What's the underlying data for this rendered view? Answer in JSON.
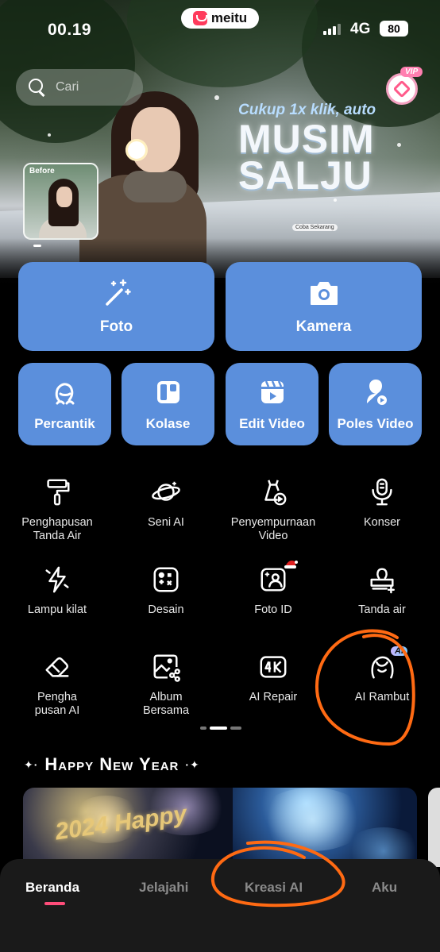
{
  "status": {
    "time": "00.19",
    "network": "4G",
    "battery": "80",
    "app_badge": "meitu"
  },
  "search": {
    "placeholder": "Cari"
  },
  "vip": {
    "tag": "VIP"
  },
  "banner": {
    "subtitle": "Cukup 1x klik, auto",
    "title": "MUSIM SALJU",
    "cta": "Coba Sekarang",
    "before_label": "Before"
  },
  "main_buttons": [
    {
      "label": "Foto",
      "icon": "magic-wand-icon"
    },
    {
      "label": "Kamera",
      "icon": "camera-icon"
    }
  ],
  "secondary_buttons": [
    {
      "label": "Percantik",
      "icon": "face-hair-icon"
    },
    {
      "label": "Kolase",
      "icon": "collage-icon"
    },
    {
      "label": "Edit Video",
      "icon": "video-edit-icon"
    },
    {
      "label": "Poles Video",
      "icon": "portrait-play-icon"
    }
  ],
  "tools": [
    {
      "label": "Penghapusan\nTanda Air",
      "icon": "paint-roller-icon"
    },
    {
      "label": "Seni AI",
      "icon": "planet-icon"
    },
    {
      "label": "Penyempurnaan\nVideo",
      "icon": "dress-play-icon"
    },
    {
      "label": "Konser",
      "icon": "microphone-icon"
    },
    {
      "label": "Lampu kilat",
      "icon": "flash-icon"
    },
    {
      "label": "Desain",
      "icon": "design-grid-icon"
    },
    {
      "label": "Foto ID",
      "icon": "id-photo-icon"
    },
    {
      "label": "Tanda air",
      "icon": "stamp-icon"
    },
    {
      "label": "Pengha\npusan AI",
      "icon": "eraser-icon"
    },
    {
      "label": "Album\nBersama",
      "icon": "shared-album-icon"
    },
    {
      "label": "AI Repair",
      "icon": "4k-icon"
    },
    {
      "label": "AI Rambut",
      "icon": "hair-icon",
      "badge": "AI"
    }
  ],
  "section": {
    "title": "Happy New Year"
  },
  "cards": {
    "fireworks_text": "2024 Happy"
  },
  "nav": [
    {
      "label": "Beranda",
      "active": true
    },
    {
      "label": "Jelajahi",
      "active": false
    },
    {
      "label": "Kreasi AI",
      "active": false
    },
    {
      "label": "Aku",
      "active": false
    }
  ],
  "colors": {
    "primary_button": "#5b8fdc",
    "nav_accent": "#ff4d7a",
    "annotation": "#ff6a13",
    "background": "#000000"
  }
}
